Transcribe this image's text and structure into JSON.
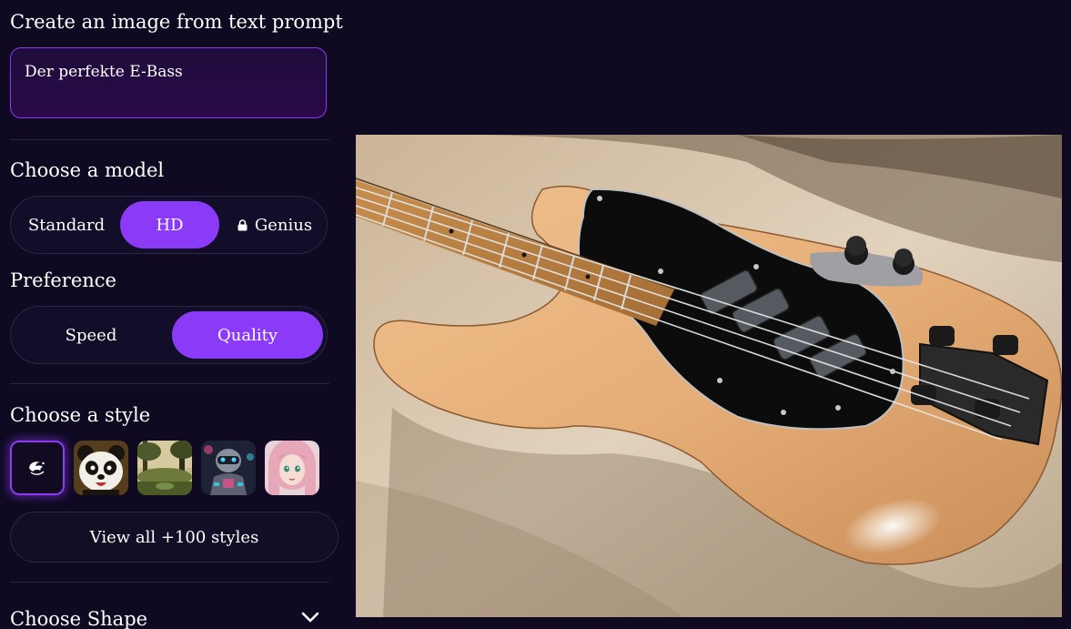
{
  "prompt": {
    "title": "Create an image from text prompt",
    "value": "Der perfekte E-Bass"
  },
  "model": {
    "title": "Choose a model",
    "options": [
      {
        "label": "Standard",
        "active": false,
        "locked": false
      },
      {
        "label": "HD",
        "active": true,
        "locked": false
      },
      {
        "label": "Genius",
        "active": false,
        "locked": true
      }
    ]
  },
  "preference": {
    "title": "Preference",
    "options": [
      {
        "label": "Speed",
        "active": false
      },
      {
        "label": "Quality",
        "active": true
      }
    ]
  },
  "style": {
    "title": "Choose a style",
    "thumbnails": [
      "no-style-icon",
      "panda",
      "forest",
      "robot",
      "anime-girl"
    ],
    "view_all_label": "View all +100 styles"
  },
  "shape": {
    "title": "Choose Shape",
    "expand_icon": "chevron-down-icon"
  },
  "colors": {
    "accent": "#8b3bf7",
    "background": "#0f0a22",
    "border": "#2c2744"
  }
}
